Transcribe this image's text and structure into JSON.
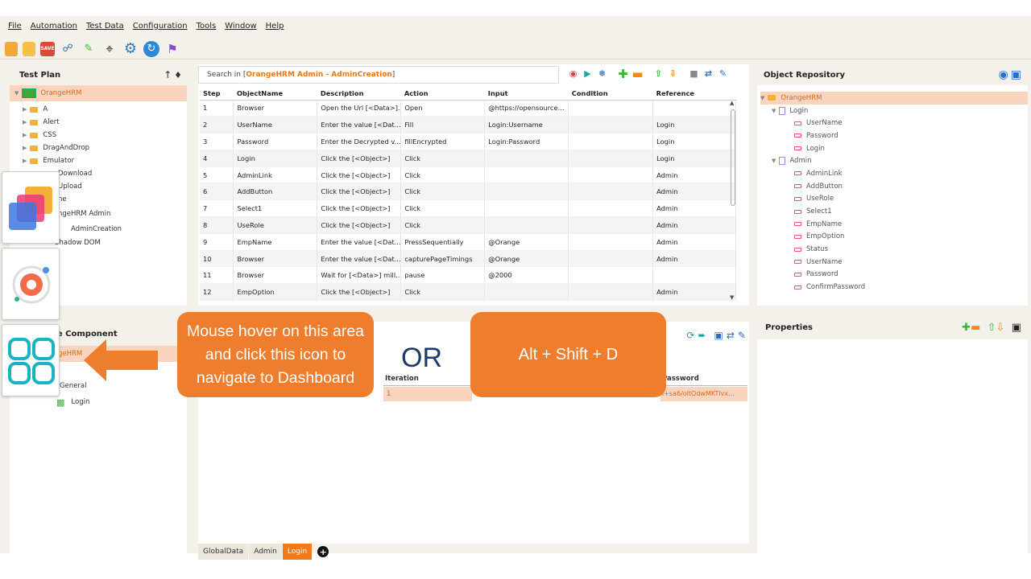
{
  "menu": [
    "File",
    "Automation",
    "Test Data",
    "Configuration",
    "Tools",
    "Window",
    "Help"
  ],
  "test_plan": {
    "title": "Test Plan",
    "root": "OrangeHRM",
    "items": [
      "A",
      "Alert",
      "CSS",
      "DragAndDrop",
      "Emulator"
    ],
    "partial_items": [
      "Download",
      "Upload",
      "ne",
      "ngeHRM Admin",
      "AdminCreation",
      "Shadow DOM"
    ]
  },
  "search": {
    "prefix": "Search in [ ",
    "scope": "OrangeHRM Admin - AdminCreation",
    "suffix": " ]"
  },
  "grid": {
    "columns": [
      "Step",
      "ObjectName",
      "Description",
      "Action",
      "Input",
      "Condition",
      "Reference"
    ],
    "rows": [
      [
        "1",
        "Browser",
        "Open the Url [<Data>]...",
        "Open",
        "@https://opensource...",
        "",
        ""
      ],
      [
        "2",
        "UserName",
        "Enter the value [<Dat...",
        "Fill",
        "Login:Username",
        "",
        "Login"
      ],
      [
        "3",
        "Password",
        "Enter the Decrypted v...",
        "fillEncrypted",
        "Login:Password",
        "",
        "Login"
      ],
      [
        "4",
        "Login",
        "Click the [<Object>]",
        "Click",
        "",
        "",
        "Login"
      ],
      [
        "5",
        "AdminLink",
        "Click the [<Object>]",
        "Click",
        "",
        "",
        "Admin"
      ],
      [
        "6",
        "AddButton",
        "Click the [<Object>]",
        "Click",
        "",
        "",
        "Admin"
      ],
      [
        "7",
        "Select1",
        "Click the [<Object>]",
        "Click",
        "",
        "",
        "Admin"
      ],
      [
        "8",
        "UseRole",
        "Click the [<Object>]",
        "Click",
        "",
        "",
        "Admin"
      ],
      [
        "9",
        "EmpName",
        "Enter the value [<Dat...",
        "PressSequentially",
        "@Orange",
        "",
        "Admin"
      ],
      [
        "10",
        "Browser",
        "Enter the value [<Dat...",
        "capturePageTimings",
        "@Orange",
        "",
        "Admin"
      ],
      [
        "11",
        "Browser",
        "Wait for [<Data>] mill...",
        "pause",
        "@2000",
        "",
        ""
      ],
      [
        "12",
        "EmpOption",
        "Click the [<Object>]",
        "Click",
        "",
        "",
        "Admin"
      ]
    ]
  },
  "object_repository": {
    "title": "Object Repository",
    "root": "OrangeHRM",
    "pages": [
      {
        "name": "Login",
        "objects": [
          "UserName",
          "Password",
          "Login"
        ]
      },
      {
        "name": "Admin",
        "objects": [
          "AdminLink",
          "AddButton",
          "UseRole",
          "Select1",
          "EmpName",
          "EmpOption",
          "Status",
          "UserName",
          "Password",
          "ConfirmPassword"
        ]
      }
    ]
  },
  "properties": {
    "title": "Properties"
  },
  "reusable": {
    "title": "Reusable Component",
    "root_partial": "geHRM",
    "items_partial": [
      "General",
      "Login"
    ]
  },
  "data_table": {
    "col_iteration": "Iteration",
    "col_password": "Password",
    "row_iteration": "1",
    "row_password": "l+sa6/oltOdwMKTlvx..."
  },
  "sheet_tabs": [
    "GlobalData",
    "Admin",
    "Login"
  ],
  "callouts": {
    "left": "Mouse hover on this area and click this icon to navigate to Dashboard",
    "or": "OR",
    "right": "Alt + Shift + D"
  },
  "colors": {
    "accent": "#f07a1c",
    "callout": "#ee7e2e",
    "selection": "#fad4bc"
  }
}
